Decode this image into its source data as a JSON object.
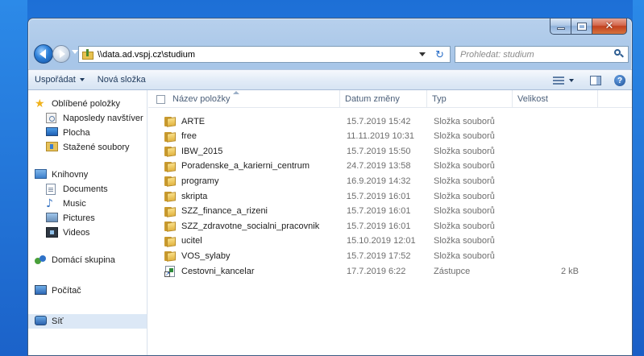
{
  "window": {
    "address": "\\\\data.ad.vspj.cz\\studium",
    "search_placeholder": "Prohledat: studium"
  },
  "toolbar": {
    "organize_label": "Uspořádat",
    "new_folder_label": "Nová složka"
  },
  "sidebar": {
    "favorites": "Oblíbené položky",
    "recent": "Naposledy navštíver",
    "desktop": "Plocha",
    "downloads": "Stažené soubory",
    "libraries": "Knihovny",
    "documents": "Documents",
    "music": "Music",
    "pictures": "Pictures",
    "videos": "Videos",
    "homegroup": "Domácí skupina",
    "computer": "Počítač",
    "network": "Síť"
  },
  "columns": {
    "name": "Název položky",
    "date": "Datum změny",
    "type": "Typ",
    "size": "Velikost"
  },
  "files": [
    {
      "name": "ARTE",
      "date": "15.7.2019 15:42",
      "type": "Složka souborů",
      "size": "",
      "icon": "folder"
    },
    {
      "name": "free",
      "date": "11.11.2019 10:31",
      "type": "Složka souborů",
      "size": "",
      "icon": "folder"
    },
    {
      "name": "IBW_2015",
      "date": "15.7.2019 15:50",
      "type": "Složka souborů",
      "size": "",
      "icon": "folder"
    },
    {
      "name": "Poradenske_a_karierni_centrum",
      "date": "24.7.2019 13:58",
      "type": "Složka souborů",
      "size": "",
      "icon": "folder"
    },
    {
      "name": "programy",
      "date": "16.9.2019 14:32",
      "type": "Složka souborů",
      "size": "",
      "icon": "folder"
    },
    {
      "name": "skripta",
      "date": "15.7.2019 16:01",
      "type": "Složka souborů",
      "size": "",
      "icon": "folder"
    },
    {
      "name": "SZZ_finance_a_rizeni",
      "date": "15.7.2019 16:01",
      "type": "Složka souborů",
      "size": "",
      "icon": "folder"
    },
    {
      "name": "SZZ_zdravotne_socialni_pracovnik",
      "date": "15.7.2019 16:01",
      "type": "Složka souborů",
      "size": "",
      "icon": "folder"
    },
    {
      "name": "ucitel",
      "date": "15.10.2019 12:01",
      "type": "Složka souborů",
      "size": "",
      "icon": "folder"
    },
    {
      "name": "VOS_sylaby",
      "date": "15.7.2019 17:52",
      "type": "Složka souborů",
      "size": "",
      "icon": "folder"
    },
    {
      "name": "Cestovni_kancelar",
      "date": "17.7.2019 6:22",
      "type": "Zástupce",
      "size": "2 kB",
      "icon": "shortcut"
    }
  ]
}
